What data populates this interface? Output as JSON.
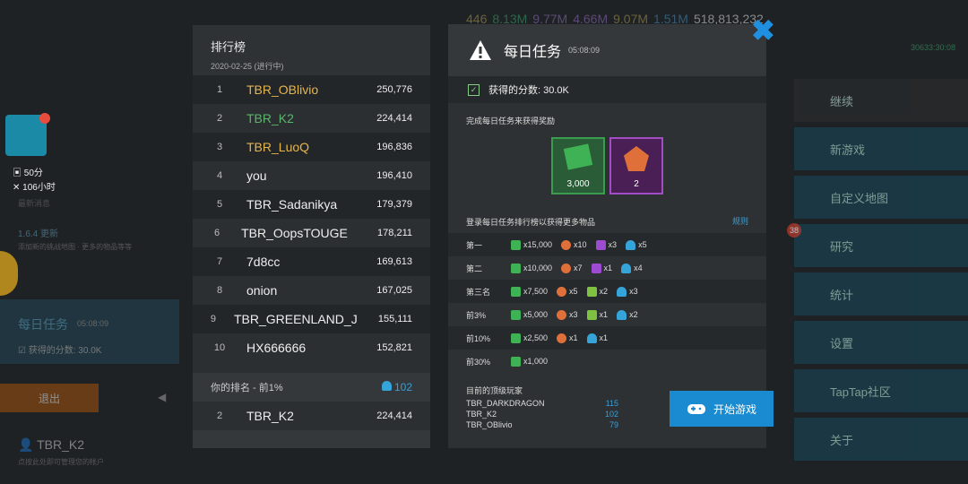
{
  "background": {
    "top_stats": [
      "446",
      "8.13M",
      "9.77M",
      "4.66M",
      "9.07M",
      "1.51M",
      "518,813,232"
    ],
    "sub_stat": "30633:30:08",
    "menu": [
      "继续",
      "新游戏",
      "自定义地图",
      "研究",
      "统计",
      "设置",
      "TapTap社区",
      "关于"
    ],
    "research_badge": "38",
    "left": {
      "stat1": "50分",
      "stat2": "106小时",
      "stat3": "最新消息",
      "version": "1.6.4 更新",
      "version_note": "添加新的挑战地图 · 更多的物品等等",
      "daily_title": "每日任务",
      "daily_time": "05:08:09",
      "daily_score": "获得的分数: 30.0K",
      "exit": "退出",
      "user": "TBR_K2",
      "user_note": "点按此处即可管理您的帐户"
    }
  },
  "leaderboard": {
    "title": "排行榜",
    "date": "2020-02-25 (进行中)",
    "rows": [
      {
        "rank": "1",
        "name": "TBR_OBlivio",
        "score": "250,776"
      },
      {
        "rank": "2",
        "name": "TBR_K2",
        "score": "224,414"
      },
      {
        "rank": "3",
        "name": "TBR_LuoQ",
        "score": "196,836"
      },
      {
        "rank": "4",
        "name": "you",
        "score": "196,410"
      },
      {
        "rank": "5",
        "name": "TBR_Sadanikya",
        "score": "179,379"
      },
      {
        "rank": "6",
        "name": "TBR_OopsTOUGE",
        "score": "178,211"
      },
      {
        "rank": "7",
        "name": "7d8cc",
        "score": "169,613"
      },
      {
        "rank": "8",
        "name": "onion",
        "score": "167,025"
      },
      {
        "rank": "9",
        "name": "TBR_GREENLAND_J",
        "score": "155,111"
      },
      {
        "rank": "10",
        "name": "HX666666",
        "score": "152,821"
      }
    ],
    "mine_label": "你的排名 - 前1%",
    "mine_badge": "102",
    "mine_rank": "2",
    "mine_name": "TBR_K2",
    "mine_score": "224,414"
  },
  "daily_task": {
    "title": "每日任务",
    "time": "05:08:09",
    "score": "获得的分数: 30.0K",
    "complete_label": "完成每日任务来获得奖励",
    "reward_green": "3,000",
    "reward_purple": "2",
    "board_label": "登录每日任务排行榜以获得更多物品",
    "rules": "规则",
    "tiers": [
      {
        "name": "第一",
        "items": [
          [
            "g",
            "x15,000"
          ],
          [
            "o",
            "x10"
          ],
          [
            "p",
            "x3"
          ],
          [
            "b",
            "x5"
          ]
        ]
      },
      {
        "name": "第二",
        "items": [
          [
            "g",
            "x10,000"
          ],
          [
            "o",
            "x7"
          ],
          [
            "p",
            "x1"
          ],
          [
            "b",
            "x4"
          ]
        ]
      },
      {
        "name": "第三名",
        "items": [
          [
            "g",
            "x7,500"
          ],
          [
            "o",
            "x5"
          ],
          [
            "l",
            "x2"
          ],
          [
            "b",
            "x3"
          ]
        ]
      },
      {
        "name": "前3%",
        "items": [
          [
            "g",
            "x5,000"
          ],
          [
            "o",
            "x3"
          ],
          [
            "l",
            "x1"
          ],
          [
            "b",
            "x2"
          ]
        ]
      },
      {
        "name": "前10%",
        "items": [
          [
            "g",
            "x2,500"
          ],
          [
            "o",
            "x1"
          ],
          [
            "b",
            "x1"
          ]
        ]
      },
      {
        "name": "前30%",
        "items": [
          [
            "g",
            "x1,000"
          ]
        ]
      }
    ],
    "top_label": "目前的顶级玩家",
    "top_players": [
      {
        "name": "TBR_DARKDRAGON",
        "val": "115"
      },
      {
        "name": "TBR_K2",
        "val": "102"
      },
      {
        "name": "TBR_OBlivio",
        "val": "79"
      }
    ],
    "play_button": "开始游戏"
  }
}
